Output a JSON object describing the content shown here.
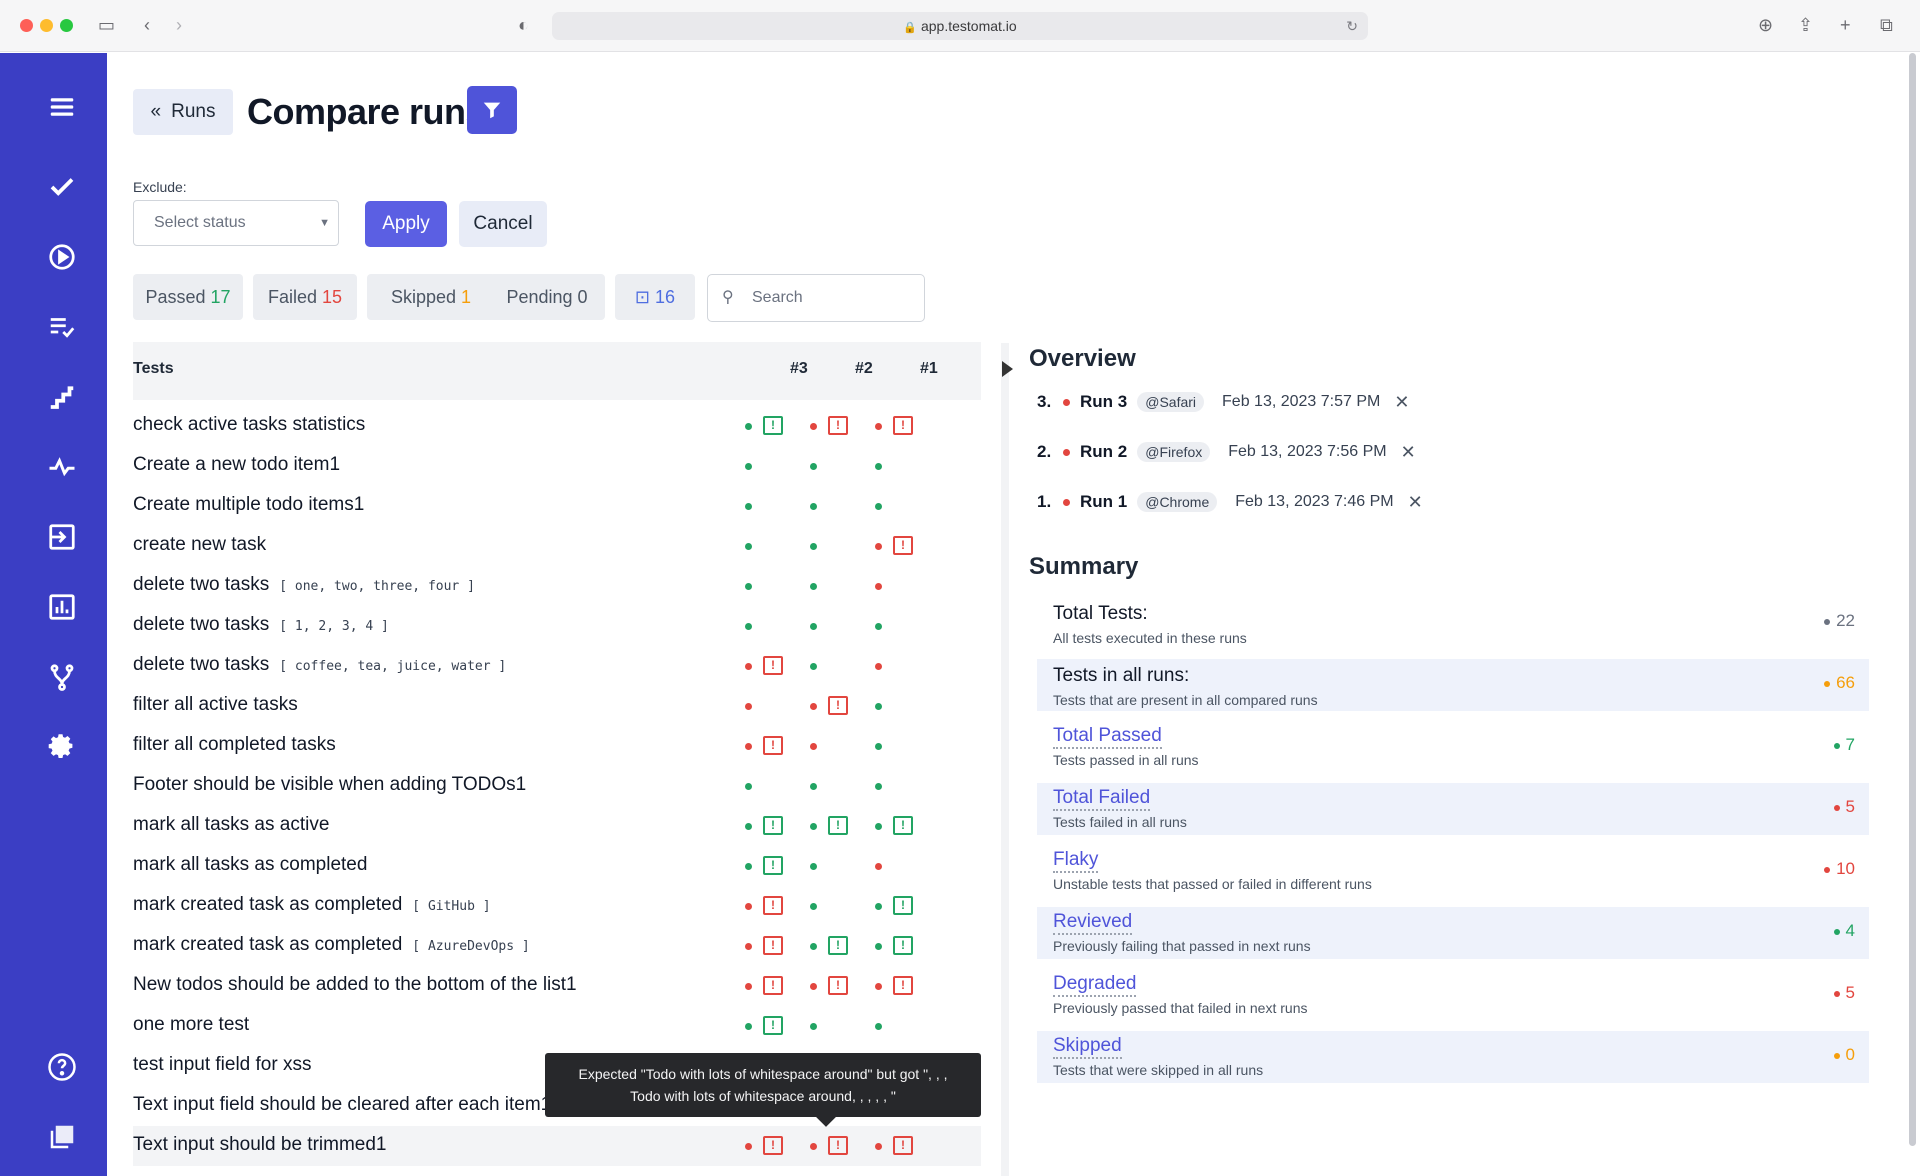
{
  "browser": {
    "url": "app.testomat.io"
  },
  "header": {
    "back_label": "Runs",
    "title": "Compare runs"
  },
  "exclude": {
    "label": "Exclude:",
    "placeholder": "Select status",
    "apply": "Apply",
    "cancel": "Cancel"
  },
  "pills": {
    "passed_label": "Passed",
    "passed_count": "17",
    "failed_label": "Failed",
    "failed_count": "15",
    "skipped_label": "Skipped",
    "skipped_count": "1",
    "pending_label": "Pending",
    "pending_count": "0",
    "messages_count": "16"
  },
  "search": {
    "placeholder": "Search"
  },
  "table": {
    "col_tests": "Tests",
    "col_runs": [
      "#3",
      "#2",
      "#1"
    ],
    "rows": [
      {
        "name": "check active tasks statistics",
        "params": "",
        "r3": [
          "g",
          "msg-g"
        ],
        "r2": [
          "r",
          "msg-r"
        ],
        "r1": [
          "r",
          "msg-r"
        ]
      },
      {
        "name": "Create a new todo item1",
        "params": "",
        "r3": [
          "g"
        ],
        "r2": [
          "g"
        ],
        "r1": [
          "g"
        ]
      },
      {
        "name": "Create multiple todo items1",
        "params": "",
        "r3": [
          "g"
        ],
        "r2": [
          "g"
        ],
        "r1": [
          "g"
        ]
      },
      {
        "name": "create new task",
        "params": "",
        "r3": [
          "g"
        ],
        "r2": [
          "g"
        ],
        "r1": [
          "r",
          "msg-r"
        ]
      },
      {
        "name": "delete two tasks",
        "params": "[ one, two, three, four ]",
        "r3": [
          "g"
        ],
        "r2": [
          "g"
        ],
        "r1": [
          "r"
        ]
      },
      {
        "name": "delete two tasks",
        "params": "[ 1, 2, 3, 4 ]",
        "r3": [
          "g"
        ],
        "r2": [
          "g"
        ],
        "r1": [
          "g"
        ]
      },
      {
        "name": "delete two tasks",
        "params": "[ coffee, tea, juice, water ]",
        "r3": [
          "r",
          "msg-r"
        ],
        "r2": [
          "g"
        ],
        "r1": [
          "r"
        ]
      },
      {
        "name": "filter all active tasks",
        "params": "",
        "r3": [
          "r"
        ],
        "r2": [
          "r",
          "msg-r"
        ],
        "r1": [
          "g"
        ]
      },
      {
        "name": "filter all completed tasks",
        "params": "",
        "r3": [
          "r",
          "msg-r"
        ],
        "r2": [
          "r"
        ],
        "r1": [
          "g"
        ]
      },
      {
        "name": "Footer should be visible when adding TODOs1",
        "params": "",
        "r3": [
          "g"
        ],
        "r2": [
          "g"
        ],
        "r1": [
          "g"
        ]
      },
      {
        "name": "mark all tasks as active",
        "params": "",
        "r3": [
          "g",
          "msg-g"
        ],
        "r2": [
          "g",
          "msg-g"
        ],
        "r1": [
          "g",
          "msg-g"
        ]
      },
      {
        "name": "mark all tasks as completed",
        "params": "",
        "r3": [
          "g",
          "msg-g"
        ],
        "r2": [
          "g"
        ],
        "r1": [
          "r"
        ]
      },
      {
        "name": "mark created task as completed",
        "params": "[ GitHub ]",
        "r3": [
          "r",
          "msg-r"
        ],
        "r2": [
          "g"
        ],
        "r1": [
          "g",
          "msg-g"
        ]
      },
      {
        "name": "mark created task as completed",
        "params": "[ AzureDevOps ]",
        "r3": [
          "r",
          "msg-r"
        ],
        "r2": [
          "g",
          "msg-g"
        ],
        "r1": [
          "g",
          "msg-g"
        ]
      },
      {
        "name": "New todos should be added to the bottom of the list1",
        "params": "",
        "r3": [
          "r",
          "msg-r"
        ],
        "r2": [
          "r",
          "msg-r"
        ],
        "r1": [
          "r",
          "msg-r"
        ]
      },
      {
        "name": "one more test",
        "params": "",
        "r3": [
          "g",
          "msg-g"
        ],
        "r2": [
          "g"
        ],
        "r1": [
          "g"
        ]
      },
      {
        "name": "test input field for xss",
        "params": "",
        "r3": [],
        "r2": [],
        "r1": []
      },
      {
        "name": "Text input field should be cleared after each item1",
        "params": "",
        "r3": [],
        "r2": [],
        "r1": []
      },
      {
        "name": "Text input should be trimmed1",
        "params": "",
        "r3": [
          "r",
          "msg-r"
        ],
        "r2": [
          "r",
          "msg-r"
        ],
        "r1": [
          "r",
          "msg-r"
        ]
      }
    ]
  },
  "tooltip": {
    "text": "Expected \"Todo with lots of whitespace around\" but got \", , , Todo with lots of whitespace around, , , , , \""
  },
  "overview": {
    "title": "Overview",
    "runs": [
      {
        "num": "3.",
        "name": "Run 3",
        "tag": "@Safari",
        "date": "Feb 13, 2023 7:57 PM"
      },
      {
        "num": "2.",
        "name": "Run 2",
        "tag": "@Firefox",
        "date": "Feb 13, 2023 7:56 PM"
      },
      {
        "num": "1.",
        "name": "Run 1",
        "tag": "@Chrome",
        "date": "Feb 13, 2023 7:46 PM"
      }
    ]
  },
  "summary": {
    "title": "Summary",
    "items": [
      {
        "title": "Total Tests:",
        "desc": "All tests executed in these runs",
        "value": "22",
        "color": "#6b7280",
        "link": false
      },
      {
        "title": "Tests in all runs:",
        "desc": "Tests that are present in all compared runs",
        "value": "66",
        "color": "#f59e0b",
        "link": false
      },
      {
        "title": "Total Passed",
        "desc": "Tests passed in all runs",
        "value": "7",
        "color": "#22a463",
        "link": true
      },
      {
        "title": "Total Failed",
        "desc": "Tests failed in all runs",
        "value": "5",
        "color": "#e2463f",
        "link": true
      },
      {
        "title": "Flaky",
        "desc": "Unstable tests that passed or failed in different runs",
        "value": "10",
        "color": "#e2463f",
        "link": true
      },
      {
        "title": "Revieved",
        "desc": "Previously failing that passed in next runs",
        "value": "4",
        "color": "#22a463",
        "link": true
      },
      {
        "title": "Degraded",
        "desc": "Previously passed that failed in next runs",
        "value": "5",
        "color": "#e2463f",
        "link": true
      },
      {
        "title": "Skipped",
        "desc": "Tests that were skipped in all runs",
        "value": "0",
        "color": "#f59e0b",
        "link": true
      }
    ]
  }
}
